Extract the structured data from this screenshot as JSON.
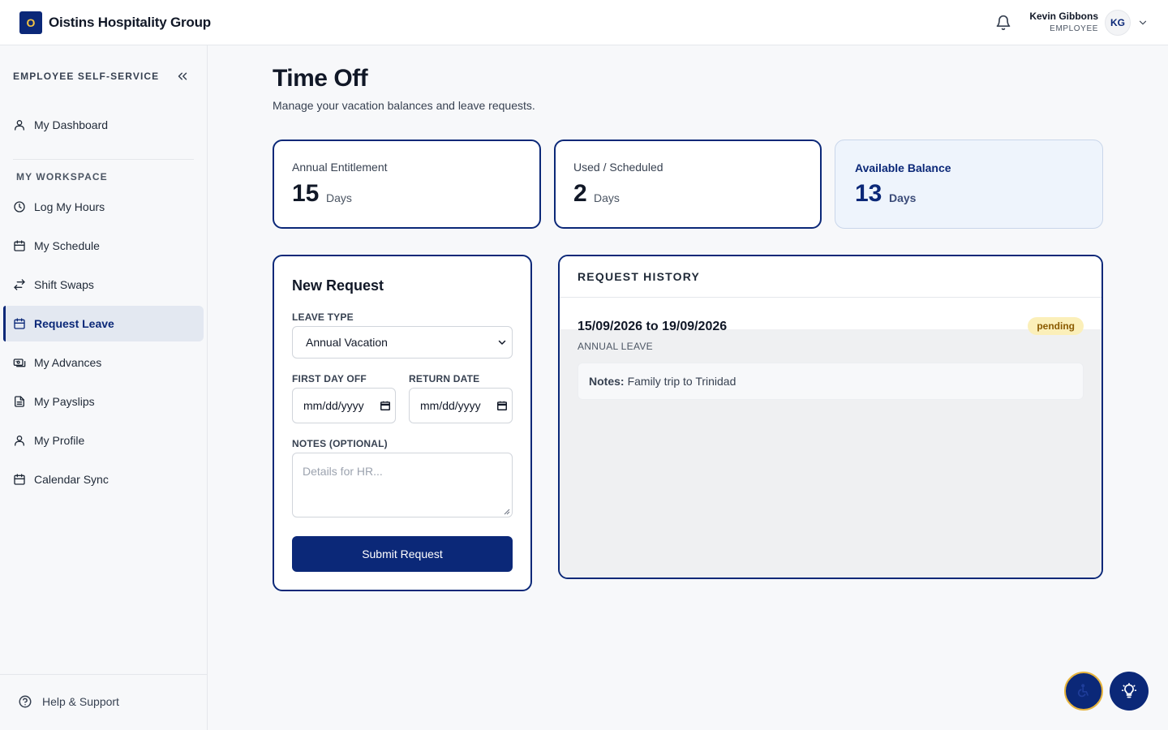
{
  "header": {
    "logo_letter": "O",
    "company": "Oistins Hospitality Group",
    "user_name": "Kevin Gibbons",
    "user_role": "EMPLOYEE",
    "avatar_initials": "KG"
  },
  "sidebar": {
    "heading": "EMPLOYEE SELF-SERVICE",
    "dashboard": "My Dashboard",
    "section": "MY WORKSPACE",
    "items": [
      {
        "label": "Log My Hours",
        "icon": "clock-icon"
      },
      {
        "label": "My Schedule",
        "icon": "calendar-icon"
      },
      {
        "label": "Shift Swaps",
        "icon": "swap-icon"
      },
      {
        "label": "Request Leave",
        "icon": "calendar-icon",
        "active": true
      },
      {
        "label": "My Advances",
        "icon": "cash-icon"
      },
      {
        "label": "My Payslips",
        "icon": "document-icon"
      },
      {
        "label": "My Profile",
        "icon": "user-icon"
      },
      {
        "label": "Calendar Sync",
        "icon": "calendar-icon"
      }
    ],
    "help": "Help & Support"
  },
  "main": {
    "title": "Time Off",
    "subtitle": "Manage your vacation balances and leave requests.",
    "stats": [
      {
        "label": "Annual Entitlement",
        "value": "15",
        "unit": "Days"
      },
      {
        "label": "Used / Scheduled",
        "value": "2",
        "unit": "Days"
      },
      {
        "label": "Available Balance",
        "value": "13",
        "unit": "Days"
      }
    ],
    "form": {
      "title": "New Request",
      "leave_type_label": "LEAVE TYPE",
      "leave_type_value": "Annual Vacation",
      "first_day_label": "FIRST DAY OFF",
      "return_date_label": "RETURN DATE",
      "date_placeholder": "mm/dd/yyyy",
      "notes_label": "NOTES (OPTIONAL)",
      "notes_placeholder": "Details for HR...",
      "submit": "Submit Request"
    },
    "history": {
      "title": "REQUEST HISTORY",
      "entries": [
        {
          "dates": "15/09/2026 to 19/09/2026",
          "status": "pending",
          "type": "ANNUAL LEAVE",
          "notes_label": "Notes:",
          "notes": "Family trip to Trinidad"
        }
      ]
    }
  },
  "colors": {
    "primary": "#0b2878",
    "gold": "#d4a843",
    "pending_bg": "#fbefb9",
    "pending_text": "#8a5a00",
    "balance_bg": "#eef4fc"
  }
}
